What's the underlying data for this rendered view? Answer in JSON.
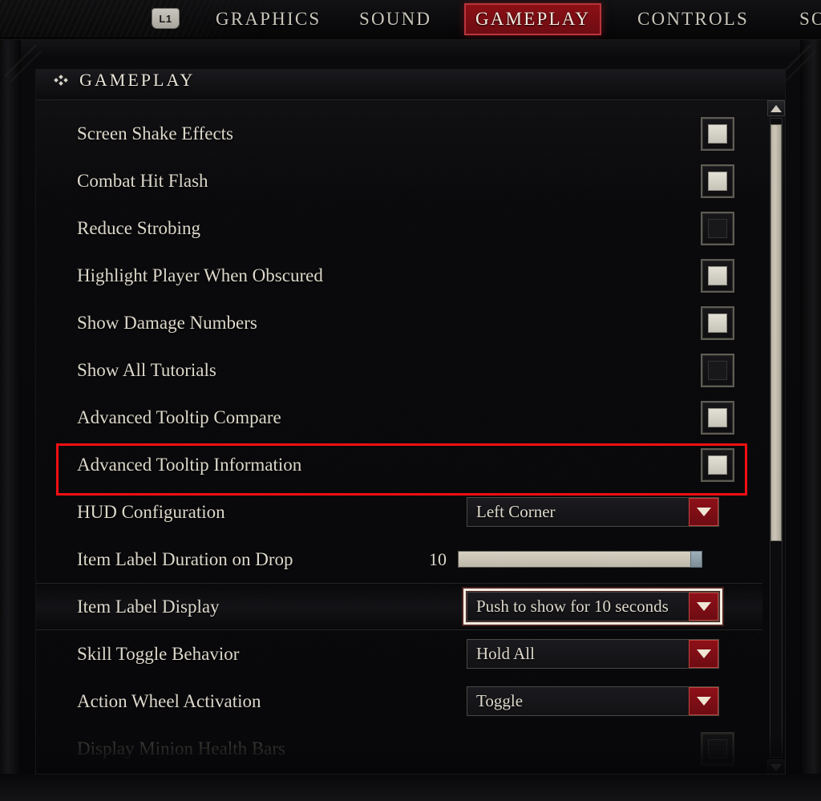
{
  "tabbar": {
    "button_hint": "L1",
    "tabs": [
      {
        "label": "GRAPHICS",
        "active": false
      },
      {
        "label": "SOUND",
        "active": false
      },
      {
        "label": "GAMEPLAY",
        "active": true
      },
      {
        "label": "CONTROLS",
        "active": false
      },
      {
        "label": "SO",
        "active": false
      }
    ],
    "active_color": "#8b1015"
  },
  "panel": {
    "section_title": "GAMEPLAY"
  },
  "settings": [
    {
      "label": "Screen Shake Effects",
      "type": "checkbox",
      "checked": true
    },
    {
      "label": "Combat Hit Flash",
      "type": "checkbox",
      "checked": true
    },
    {
      "label": "Reduce Strobing",
      "type": "checkbox",
      "checked": false
    },
    {
      "label": "Highlight Player When Obscured",
      "type": "checkbox",
      "checked": true
    },
    {
      "label": "Show Damage Numbers",
      "type": "checkbox",
      "checked": true
    },
    {
      "label": "Show All Tutorials",
      "type": "checkbox",
      "checked": false
    },
    {
      "label": "Advanced Tooltip Compare",
      "type": "checkbox",
      "checked": true
    },
    {
      "label": "Advanced Tooltip Information",
      "type": "checkbox",
      "checked": true,
      "annotated": true
    },
    {
      "label": "HUD Configuration",
      "type": "dropdown",
      "value": "Left Corner"
    },
    {
      "label": "Item Label Duration on Drop",
      "type": "slider",
      "value": "10",
      "fill_percent": 96
    },
    {
      "label": "Item Label Display",
      "type": "dropdown",
      "value": "Push to show for 10 seconds",
      "focused": true,
      "selected_row": true
    },
    {
      "label": "Skill Toggle Behavior",
      "type": "dropdown",
      "value": "Hold All"
    },
    {
      "label": "Action Wheel Activation",
      "type": "dropdown",
      "value": "Toggle"
    },
    {
      "label": "Display Minion Health Bars",
      "type": "checkbox",
      "checked": false,
      "dimmed": true
    }
  ],
  "scrollbar": {
    "up_arrow": "scroll-up-arrow",
    "down_arrow": "scroll-down-arrow"
  },
  "annotation": {
    "color": "#f40f13",
    "target": "Advanced Tooltip Information"
  }
}
